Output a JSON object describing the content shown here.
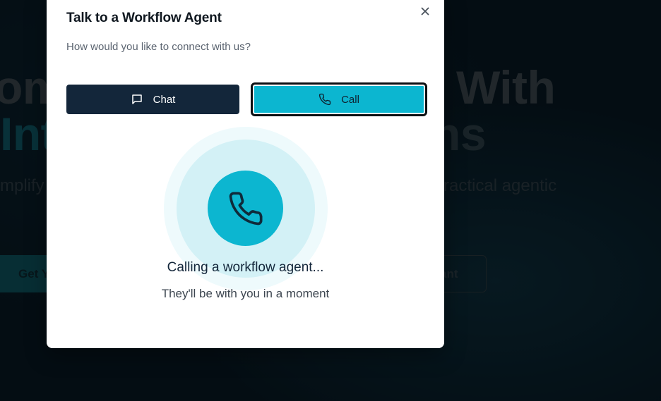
{
  "background": {
    "hero_line1_left": "om",
    "hero_line1_right": "With",
    "hero_line2_left": "Int",
    "hero_line2_right": "ns",
    "hero_sub_left": "mplify",
    "hero_sub_right": "ractical agentic",
    "cta_primary": "Get Y",
    "cta_secondary": "ant"
  },
  "modal": {
    "title": "Talk to a Workflow Agent",
    "subtitle": "How would you like to connect with us?",
    "close_icon": "close-icon",
    "options": {
      "chat_label": "Chat",
      "chat_icon": "message-square-icon",
      "call_label": "Call",
      "call_icon": "phone-icon",
      "selected": "Call"
    },
    "status": {
      "title": "Calling a workflow agent...",
      "subtitle": "They'll be with you in a moment"
    }
  },
  "colors": {
    "accent": "#0cb6d0",
    "dark_button": "#13263a",
    "pulse_light": "#eefafc",
    "pulse_mid": "#d3f1f6"
  }
}
